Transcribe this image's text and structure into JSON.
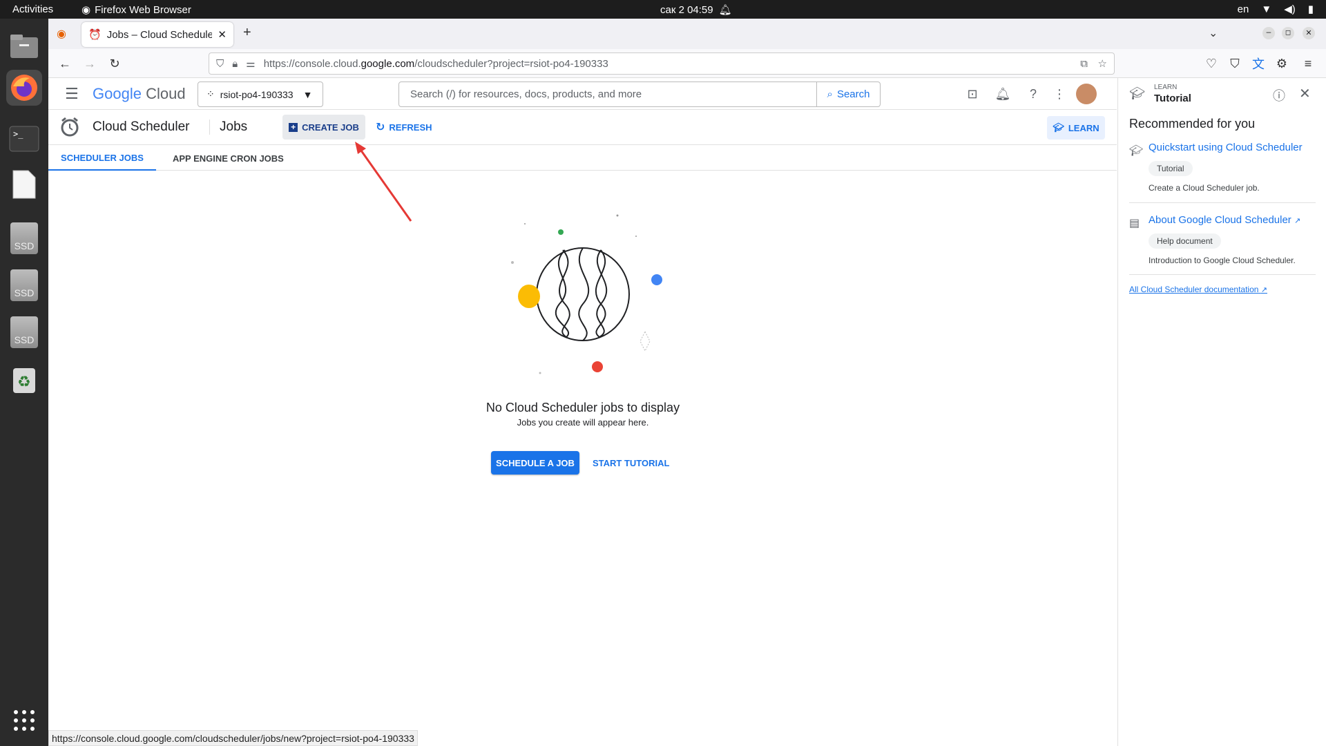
{
  "system": {
    "activities": "Activities",
    "app_name": "Firefox Web Browser",
    "clock": "сак 2  04:59",
    "lang": "en"
  },
  "browser": {
    "tab_title": "Jobs – Cloud Scheduler –",
    "url_prefix": "https://console.cloud.",
    "url_domain": "google.com",
    "url_suffix": "/cloudscheduler?project=rsiot-po4-190333",
    "status_url": "https://console.cloud.google.com/cloudscheduler/jobs/new?project=rsiot-po4-190333"
  },
  "gcp_header": {
    "logo_google": "Google",
    "logo_cloud": "Cloud",
    "project": "rsiot-po4-190333",
    "search_placeholder": "Search (/) for resources, docs, products, and more",
    "search_button": "Search"
  },
  "product": {
    "title": "Cloud Scheduler",
    "page": "Jobs",
    "create_job": "CREATE JOB",
    "refresh": "REFRESH",
    "learn": "LEARN"
  },
  "tabs": [
    "SCHEDULER JOBS",
    "APP ENGINE CRON JOBS"
  ],
  "empty_state": {
    "title": "No Cloud Scheduler jobs to display",
    "subtitle": "Jobs you create will appear here.",
    "schedule_button": "SCHEDULE A JOB",
    "tutorial_button": "START TUTORIAL"
  },
  "learn_panel": {
    "kicker": "LEARN",
    "title": "Tutorial",
    "section": "Recommended for you",
    "items": [
      {
        "title": "Quickstart using Cloud Scheduler",
        "chip": "Tutorial",
        "desc": "Create a Cloud Scheduler job."
      },
      {
        "title": "About Google Cloud Scheduler",
        "chip": "Help document",
        "desc": "Introduction to Google Cloud Scheduler."
      }
    ],
    "all_docs": "All Cloud Scheduler documentation"
  },
  "colors": {
    "accent": "#1a73e8",
    "annotation_arrow": "#e53935"
  }
}
